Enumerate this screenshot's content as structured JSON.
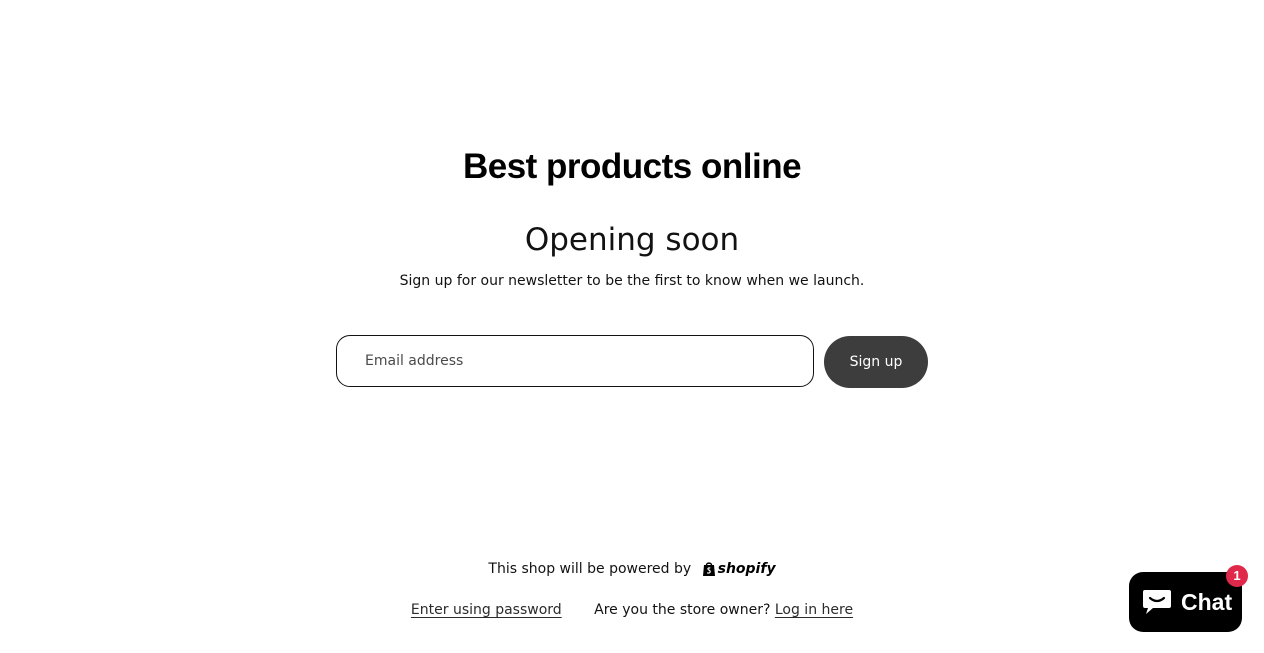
{
  "store": {
    "name": "Best products online"
  },
  "hero": {
    "headline": "Opening soon",
    "subtext": "Sign up for our newsletter to be the first to know when we launch."
  },
  "newsletter": {
    "email_placeholder": "Email address",
    "signup_label": "Sign up"
  },
  "footer": {
    "powered_by_text": "This shop will be powered by",
    "powered_by_brand": "shopify",
    "enter_password_link": "Enter using password",
    "owner_question": "Are you the store owner?",
    "login_link": "Log in here"
  },
  "chat": {
    "label": "Chat",
    "badge_count": "1",
    "icon": "chat-bubble-icon"
  },
  "colors": {
    "button_bg": "#3d3d3d",
    "chat_bg": "#000000",
    "badge_bg": "#e0284b",
    "shopify_green": "#95bf47"
  }
}
